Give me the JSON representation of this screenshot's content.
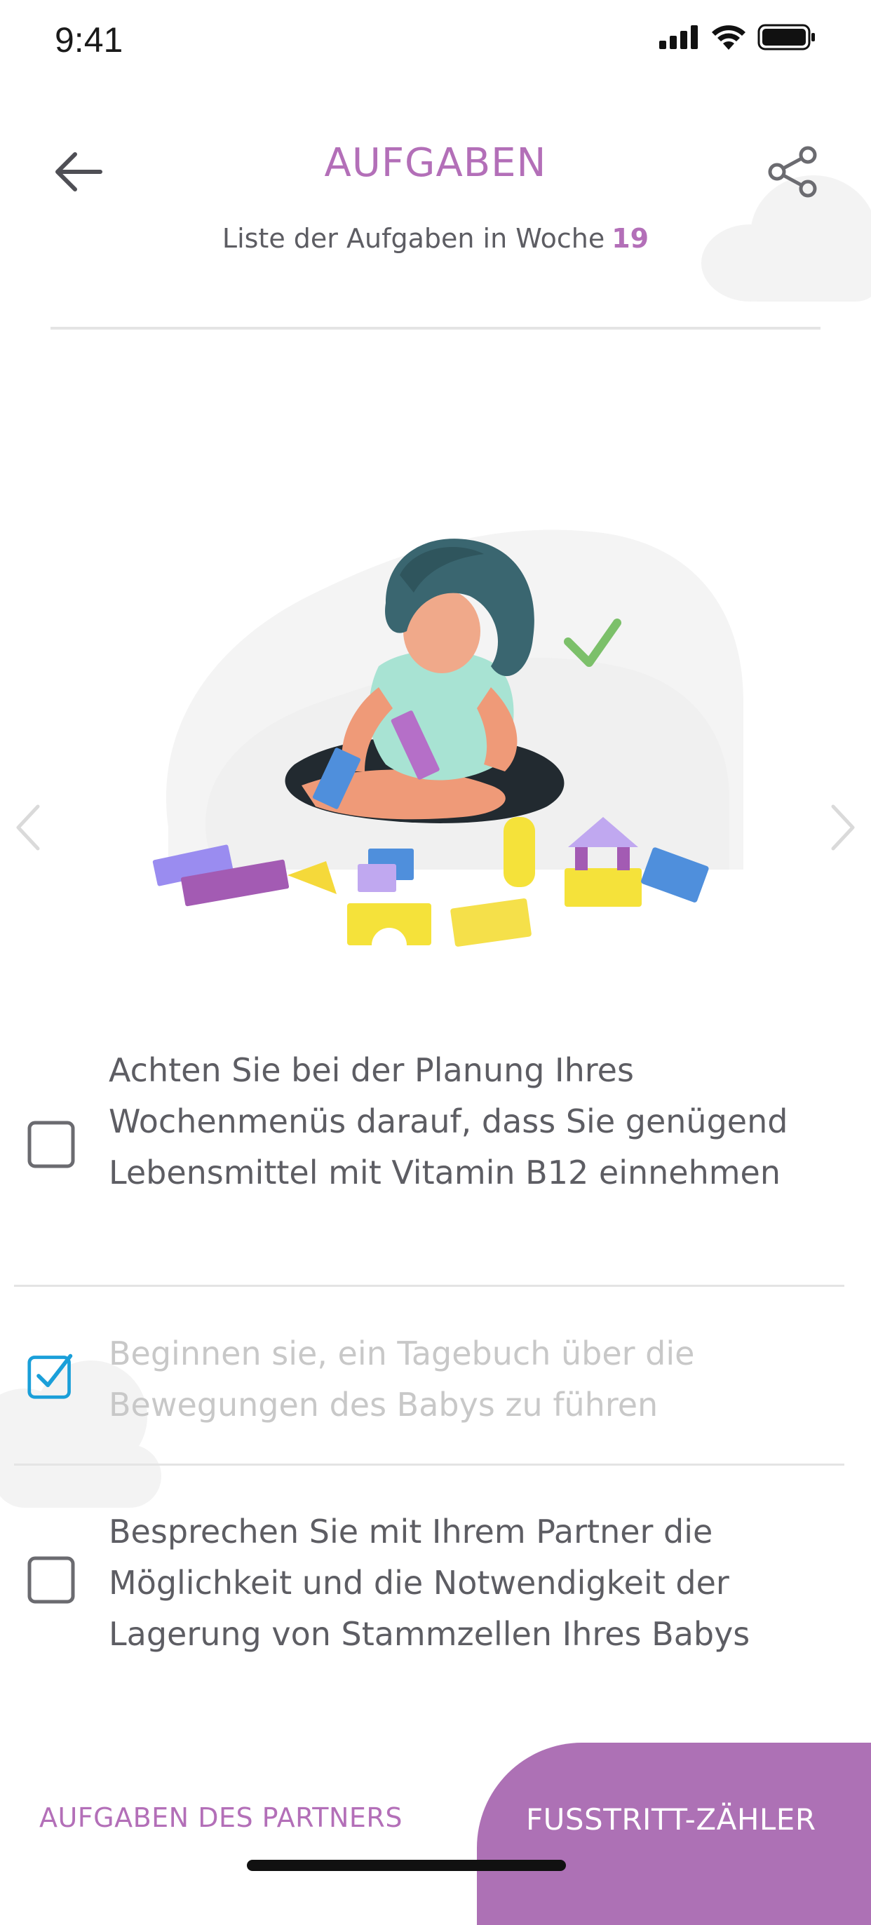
{
  "status_bar": {
    "time": "9:41",
    "icons": [
      "signal-icon",
      "wifi-icon",
      "battery-icon"
    ]
  },
  "header": {
    "title": "AUFGABEN",
    "subtitle_prefix": "Liste der Aufgaben in Woche",
    "week_number": "19",
    "back_icon": "arrow-left-icon",
    "share_icon": "share-icon"
  },
  "carousel": {
    "illustration": "woman-playing-with-blocks",
    "prev_icon": "chevron-left-icon",
    "next_icon": "chevron-right-icon"
  },
  "tasks": [
    {
      "text": "Achten Sie bei der Planung Ihres Wochenmenüs darauf, dass Sie genügend Lebensmittel mit Vitamin B12 einnehmen",
      "checked": false
    },
    {
      "text": "Beginnen sie, ein Tagebuch über die Bewegungen des Babys zu führen",
      "checked": true
    },
    {
      "text": "Besprechen Sie mit Ihrem Partner die Möglichkeit und die Notwendigkeit der Lagerung von Stammzellen Ihres Babys",
      "checked": false
    }
  ],
  "bottom_tabs": {
    "partner_tasks": "AUFGABEN DES PARTNERS",
    "kick_counter": "FUSSTRITT-ZÄHLER"
  },
  "colors": {
    "accent": "#b36fb8",
    "tab_active_bg": "#ad71b5",
    "checkbox_checked": "#1a9fd9",
    "checkmark_green": "#7cc06a",
    "text": "#5d5d63",
    "text_done": "#c8c8c8"
  }
}
